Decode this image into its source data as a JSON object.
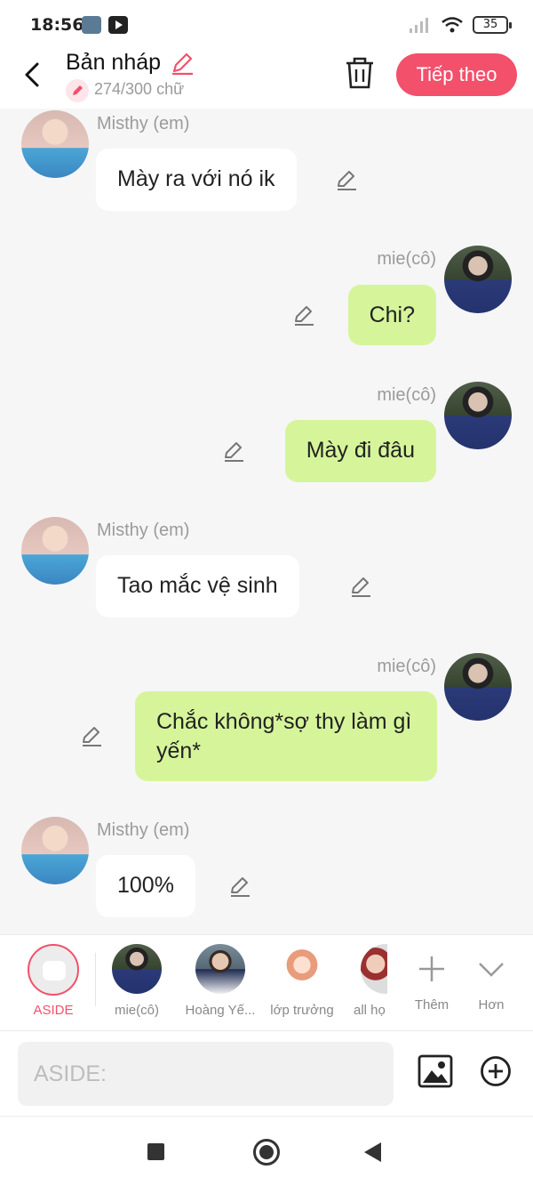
{
  "status": {
    "time": "18:56",
    "battery": "35"
  },
  "header": {
    "title": "Bản nháp",
    "count": "274/300 chữ",
    "next_label": "Tiếp theo",
    "accent": "#f2506b"
  },
  "messages": [
    {
      "sender": "Misthy (em)",
      "text": "Mày ra với nó ik",
      "side": "left"
    },
    {
      "sender": "mie(cô)",
      "text": "Chi?",
      "side": "right"
    },
    {
      "sender": "mie(cô)",
      "text": "Mày đi đâu",
      "side": "right"
    },
    {
      "sender": "Misthy (em)",
      "text": "Tao mắc vệ sinh",
      "side": "left"
    },
    {
      "sender": "mie(cô)",
      "text": "Chắc không*sợ thy làm gì yến*",
      "side": "right"
    },
    {
      "sender": "Misthy (em)",
      "text": "100%",
      "side": "left"
    }
  ],
  "characters": {
    "aside": "ASIDE",
    "items": [
      "mie(cô)",
      "Hoàng Yế...",
      "lớp trưởng",
      "all họ"
    ],
    "more_label": "Thêm",
    "expand_label": "Hơn"
  },
  "composer": {
    "placeholder": "ASIDE:"
  },
  "colors": {
    "bubble_green": "#d6f59b",
    "bubble_white": "#ffffff"
  }
}
